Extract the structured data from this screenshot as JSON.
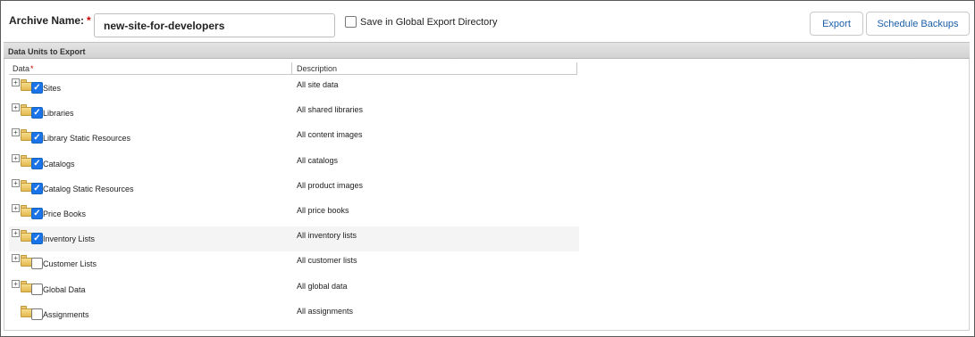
{
  "archive": {
    "label": "Archive Name:",
    "required_mark": "*",
    "value": "new-site-for-developers"
  },
  "global_export": {
    "label": "Save in Global Export Directory",
    "checked": false
  },
  "buttons": {
    "export": "Export",
    "schedule": "Schedule Backups"
  },
  "section": {
    "title": "Data Units to Export"
  },
  "grid": {
    "col_data": "Data",
    "col_data_required": "*",
    "col_description": "Description",
    "rows": [
      {
        "label": "Sites",
        "description": "All site data",
        "checked": true,
        "expandable": true,
        "highlighted": false
      },
      {
        "label": "Libraries",
        "description": "All shared libraries",
        "checked": true,
        "expandable": true,
        "highlighted": false
      },
      {
        "label": "Library Static Resources",
        "description": "All content images",
        "checked": true,
        "expandable": true,
        "highlighted": false
      },
      {
        "label": "Catalogs",
        "description": "All catalogs",
        "checked": true,
        "expandable": true,
        "highlighted": false
      },
      {
        "label": "Catalog Static Resources",
        "description": "All product images",
        "checked": true,
        "expandable": true,
        "highlighted": false
      },
      {
        "label": "Price Books",
        "description": "All price books",
        "checked": true,
        "expandable": true,
        "highlighted": false
      },
      {
        "label": "Inventory Lists",
        "description": "All inventory lists",
        "checked": true,
        "expandable": true,
        "highlighted": true
      },
      {
        "label": "Customer Lists",
        "description": "All customer lists",
        "checked": false,
        "expandable": true,
        "highlighted": false
      },
      {
        "label": "Global Data",
        "description": "All global data",
        "checked": false,
        "expandable": true,
        "highlighted": false
      },
      {
        "label": "Assignments",
        "description": "All assignments",
        "checked": false,
        "expandable": false,
        "highlighted": false
      }
    ]
  },
  "icons": {
    "expander": "plus-expander-icon",
    "folder": "folder-icon",
    "check": "✓",
    "plus": "+"
  },
  "colors": {
    "button_text": "#1b5fa8",
    "checkbox_checked": "#1a73e8",
    "required": "#cc0000"
  }
}
